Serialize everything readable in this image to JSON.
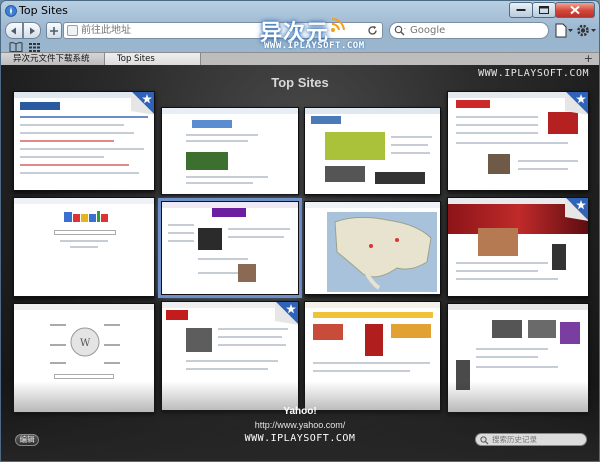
{
  "window": {
    "title": "Top Sites"
  },
  "toolbar": {
    "address_placeholder": "前往此地址",
    "search_placeholder": "Google"
  },
  "watermark": {
    "brand_cn": "异次元",
    "brand_en": "WWW.IPLAYSOFT.COM",
    "site": "WWW.IPLAYSOFT.COM"
  },
  "tabs": [
    {
      "label": "异次元文件下载系统",
      "active": false
    },
    {
      "label": "Top Sites",
      "active": true
    }
  ],
  "newtab_label": "+",
  "topsites": {
    "heading": "Top Sites",
    "selected": {
      "title": "Yahoo!",
      "url": "http://www.yahoo.com/"
    },
    "edit_label": "编辑",
    "history_search_placeholder": "搜索历史记录",
    "thumbnails": [
      {
        "name": "forum-site",
        "starred": true
      },
      {
        "name": "google-home",
        "starred": false
      },
      {
        "name": "playsoft-site",
        "starred": false
      },
      {
        "name": "chinese-portal",
        "starred": true
      },
      {
        "name": "google-search",
        "starred": false
      },
      {
        "name": "yahoo",
        "starred": false,
        "selected": true
      },
      {
        "name": "google-maps",
        "starred": false
      },
      {
        "name": "news-site",
        "starred": true
      },
      {
        "name": "wikipedia",
        "starred": false
      },
      {
        "name": "cnn",
        "starred": true
      },
      {
        "name": "ebay",
        "starred": false
      },
      {
        "name": "apple-china",
        "starred": false
      }
    ]
  },
  "colors": {
    "accent": "#6f91c8",
    "close_red": "#d2473a",
    "star_blue": "#2f63b7"
  }
}
